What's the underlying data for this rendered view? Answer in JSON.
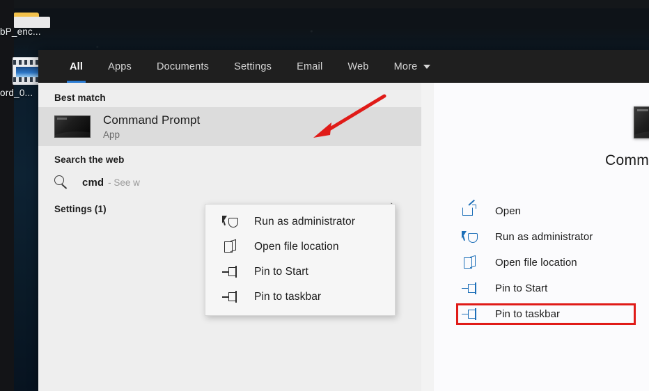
{
  "desktop": {
    "icons": [
      {
        "name": "folder-icon",
        "label": "bP_enc..."
      },
      {
        "name": "video-file-icon",
        "label": "ord_0..."
      }
    ]
  },
  "search_flyout": {
    "tabs": [
      {
        "id": "all",
        "label": "All",
        "active": true
      },
      {
        "id": "apps",
        "label": "Apps",
        "active": false
      },
      {
        "id": "documents",
        "label": "Documents",
        "active": false
      },
      {
        "id": "settings",
        "label": "Settings",
        "active": false
      },
      {
        "id": "email",
        "label": "Email",
        "active": false
      },
      {
        "id": "web",
        "label": "Web",
        "active": false
      },
      {
        "id": "more",
        "label": "More",
        "active": false,
        "caret": true
      }
    ],
    "results": {
      "best_match_header": "Best match",
      "best_match": {
        "title": "Command Prompt",
        "subtitle": "App",
        "icon": "command-prompt-icon",
        "selected": true
      },
      "search_web_header": "Search the web",
      "web_result": {
        "term": "cmd",
        "description": "- See w",
        "icon": "search-icon",
        "chevron": "›"
      },
      "settings_header": "Settings (1)"
    },
    "preview": {
      "app_title": "Comma",
      "app_icon": "command-prompt-icon",
      "actions": [
        {
          "id": "open",
          "label": "Open",
          "icon": "open-icon",
          "highlighted": false
        },
        {
          "id": "run-as-admin",
          "label": "Run as administrator",
          "icon": "shield-cursor-icon",
          "highlighted": true
        },
        {
          "id": "open-file-loc",
          "label": "Open file location",
          "icon": "folder-location-icon",
          "highlighted": false
        },
        {
          "id": "pin-to-start",
          "label": "Pin to Start",
          "icon": "pin-icon",
          "highlighted": false
        },
        {
          "id": "pin-to-taskbar",
          "label": "Pin to taskbar",
          "icon": "pin-icon",
          "highlighted": false
        }
      ]
    },
    "context_menu": {
      "items": [
        {
          "id": "run-as-admin",
          "label": "Run as administrator",
          "icon": "shield-cursor-icon"
        },
        {
          "id": "open-file-loc",
          "label": "Open file location",
          "icon": "folder-location-icon"
        },
        {
          "id": "pin-to-start",
          "label": "Pin to Start",
          "icon": "pin-icon"
        },
        {
          "id": "pin-to-taskbar",
          "label": "Pin to taskbar",
          "icon": "pin-icon"
        }
      ]
    }
  },
  "annotations": {
    "arrow": {
      "name": "red-pointer-arrow",
      "color": "#e01b18",
      "points_to": "Run as administrator"
    },
    "highlight_box": {
      "name": "red-highlight-box",
      "color": "#e01b18",
      "around": "Run as administrator"
    }
  },
  "colors": {
    "tabbar_bg": "#1f1f1f",
    "accent_blue": "#2b7cd3",
    "panel_bg": "#eeeeee",
    "preview_bg": "#fbfbfd",
    "selection_bg": "#dcdcdc",
    "annotation_red": "#e01b18",
    "icon_blue": "#1d6fb8"
  }
}
